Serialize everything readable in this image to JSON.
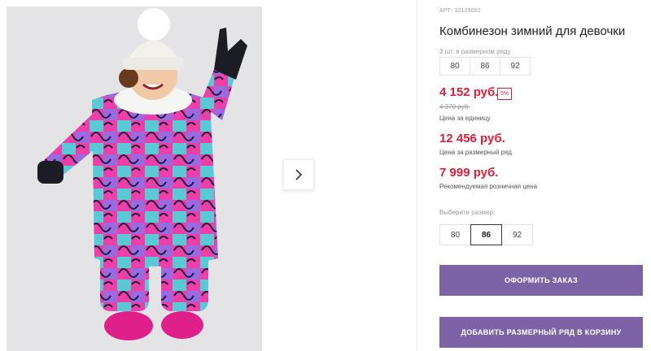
{
  "product": {
    "article": "АРТ: 32129001",
    "title": "Комбинезон зимний для девочки",
    "pack_label": "3 шт. в размерном ряду",
    "pack_sizes": [
      "80",
      "86",
      "92"
    ],
    "price": "4 152 руб.",
    "discount_badge": "5%",
    "old_price": "4 370 руб.",
    "unit_note": "Цена за единицу",
    "pack_price": "12 456 руб.",
    "pack_note": "Цена за размерный ряд",
    "retail_price": "7 999 руб.",
    "retail_note": "Рекомендуемая розничная цена",
    "choose_size_label": "Выберите размер:",
    "size_options": [
      "80",
      "86",
      "92"
    ],
    "selected_size": "86"
  },
  "buttons": {
    "order": "ОФОРМИТЬ ЗАКАЗ",
    "add_pack": "ДОБАВИТЬ РАЗМЕРНЫЙ РЯД В КОРЗИНУ"
  },
  "gallery": {
    "next_icon": "chevron-right-icon"
  },
  "colors": {
    "accent": "#7c63a5",
    "price": "#e01d39"
  }
}
